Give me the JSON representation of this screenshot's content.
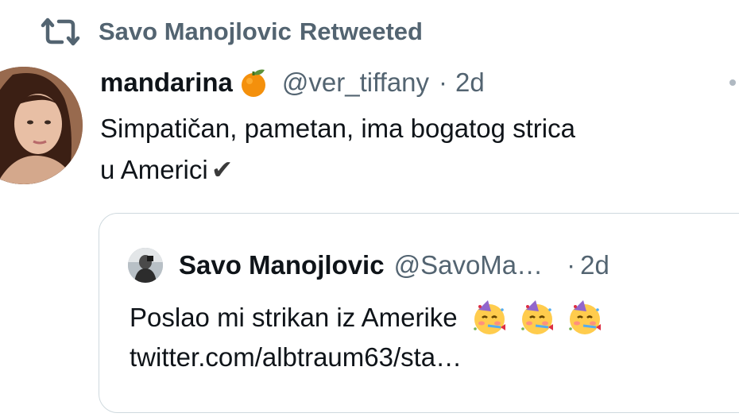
{
  "retweet_bar": {
    "icon": "retweet-icon",
    "retweeter": "Savo Manojlovic",
    "label": "Retweeted"
  },
  "tweet": {
    "avatar": "avatar",
    "display_name": "mandarina",
    "name_emoji": "tangerine-emoji",
    "handle": "@ver_tiffany",
    "separator": "·",
    "time": "2d",
    "text_line1": "Simpatičan, pametan, ima bogatog strica",
    "text_line2": "u Americi",
    "check": "✔",
    "more_icon": "more-dots-icon"
  },
  "quoted_tweet": {
    "avatar": "avatar",
    "display_name": "Savo Manojlovic",
    "handle": "@SavoMa…",
    "separator": "·",
    "time": "2d",
    "text_line1": "Poslao mi strikan iz Amerike",
    "emojis": [
      "partying-face-emoji",
      "partying-face-emoji",
      "partying-face-emoji"
    ],
    "link": "twitter.com/albtraum63/sta…"
  },
  "colors": {
    "text_primary": "#0f1419",
    "text_secondary": "#536471",
    "border": "#cfd9de"
  }
}
